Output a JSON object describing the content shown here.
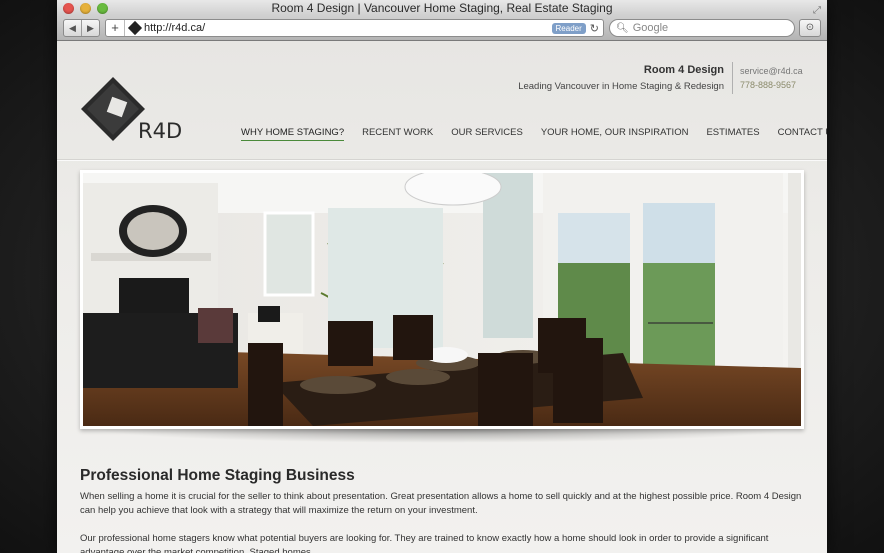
{
  "window": {
    "title": "Room 4 Design | Vancouver Home Staging, Real Estate Staging",
    "url": "http://r4d.ca/",
    "reader_label": "Reader",
    "search_placeholder": "Google"
  },
  "header": {
    "logo_text": "R4D",
    "brand_name": "Room 4 Design",
    "tagline": "Leading Vancouver in Home Staging & Redesign",
    "email": "service@r4d.ca",
    "phone": "778-888-9567"
  },
  "nav": [
    {
      "label": "WHY HOME STAGING?",
      "active": true
    },
    {
      "label": "RECENT WORK",
      "active": false
    },
    {
      "label": "OUR SERVICES",
      "active": false
    },
    {
      "label": "YOUR HOME, OUR INSPIRATION",
      "active": false
    },
    {
      "label": "ESTIMATES",
      "active": false
    },
    {
      "label": "CONTACT US",
      "active": false
    }
  ],
  "content": {
    "heading": "Professional Home Staging Business",
    "paragraph1": "When selling a home it is crucial for the seller to think about presentation. Great presentation allows a home to sell quickly and at the highest possible price. Room 4 Design can help you achieve that look with a strategy that will maximize the return on your investment.",
    "paragraph2": "Our professional home stagers know what potential buyers are looking for. They are trained to know exactly how a home should look in order to provide a significant advantage over the market competition. Staged homes..."
  },
  "colors": {
    "accent_underline": "#4a8a3a",
    "phone_color": "#8a8a6a"
  }
}
